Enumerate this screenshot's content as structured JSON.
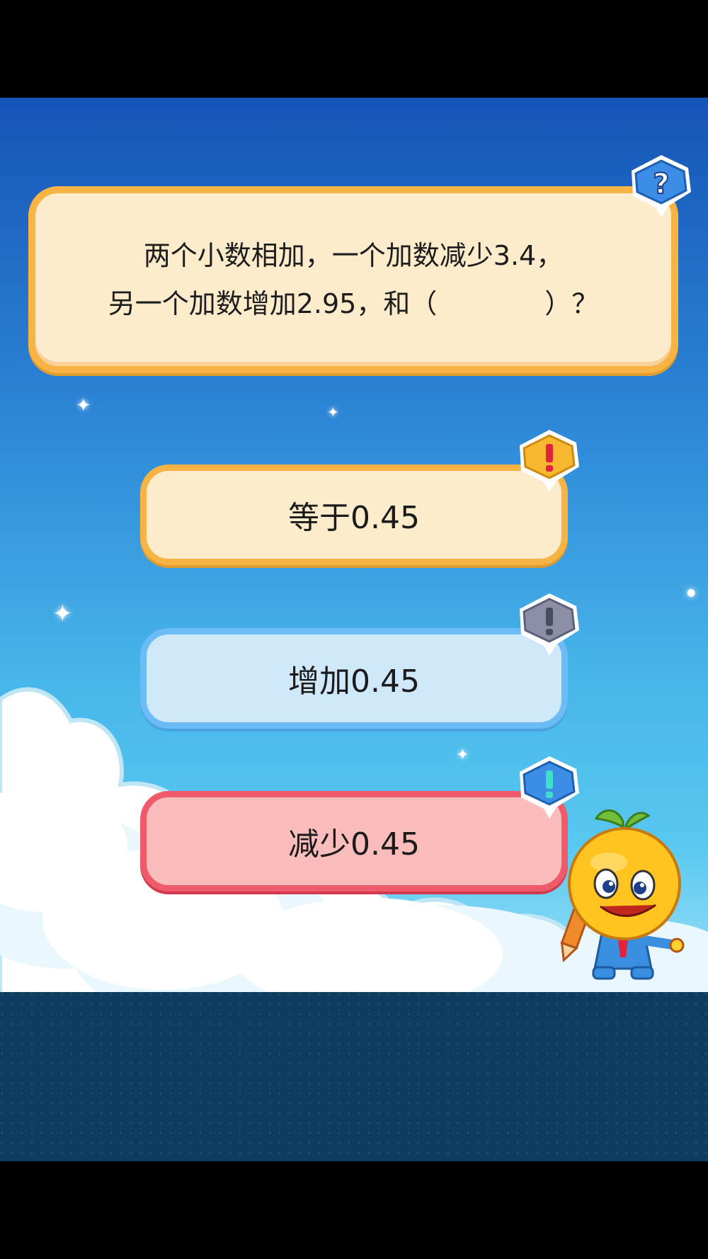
{
  "question": {
    "line1": "两个小数相加，一个加数减少3.4，",
    "line2": "另一个加数增加2.95，和（　　　　）？"
  },
  "answers": [
    {
      "label": "等于0.45",
      "badge_icon": "exclamation-icon",
      "badge_color": "#f5b82e"
    },
    {
      "label": "增加0.45",
      "badge_icon": "exclamation-icon",
      "badge_color": "#8d8fa8"
    },
    {
      "label": "减少0.45",
      "badge_icon": "exclamation-icon",
      "badge_color": "#3b8de6"
    }
  ],
  "hint_badge": {
    "icon": "question-mark-icon",
    "color": "#3b8de6"
  },
  "colors": {
    "sky_top": "#1554b7",
    "sky_bottom": "#58c8f0",
    "ground": "#0a3d5f",
    "question_fill": "#fdeccc",
    "question_border": "#f7b445"
  }
}
